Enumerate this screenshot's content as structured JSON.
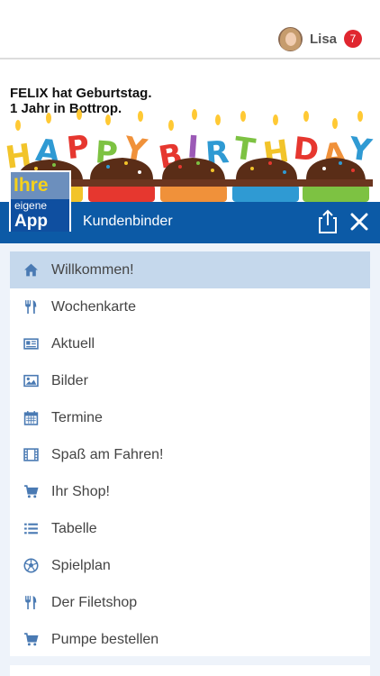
{
  "user": {
    "name": "Lisa",
    "notifications": "7"
  },
  "banner": {
    "line1": "FELIX hat Geburtstag.",
    "line2": "1 Jahr in Bottrop."
  },
  "logo": {
    "line1": "Ihre",
    "line2": "eigene",
    "line3": "App"
  },
  "titlebar": {
    "title": "Kundenbinder"
  },
  "menu": {
    "items": [
      {
        "label": "Willkommen!",
        "icon": "home-icon",
        "active": true
      },
      {
        "label": "Wochenkarte",
        "icon": "cutlery-icon"
      },
      {
        "label": "Aktuell",
        "icon": "newspaper-icon"
      },
      {
        "label": "Bilder",
        "icon": "image-icon"
      },
      {
        "label": "Termine",
        "icon": "calendar-icon"
      },
      {
        "label": "Spaß am Fahren!",
        "icon": "film-icon"
      },
      {
        "label": "Ihr Shop!",
        "icon": "cart-icon"
      },
      {
        "label": "Tabelle",
        "icon": "list-icon"
      },
      {
        "label": "Spielplan",
        "icon": "soccer-ball-icon"
      },
      {
        "label": "Der Filetshop",
        "icon": "cutlery-icon"
      },
      {
        "label": "Pumpe bestellen",
        "icon": "cart-icon"
      }
    ]
  },
  "colors": {
    "primary": "#0c5aa6",
    "active_row": "#c5d8ec",
    "icon": "#4a7ab3",
    "badge": "#e0262f",
    "menu_background": "#eef3fa"
  }
}
